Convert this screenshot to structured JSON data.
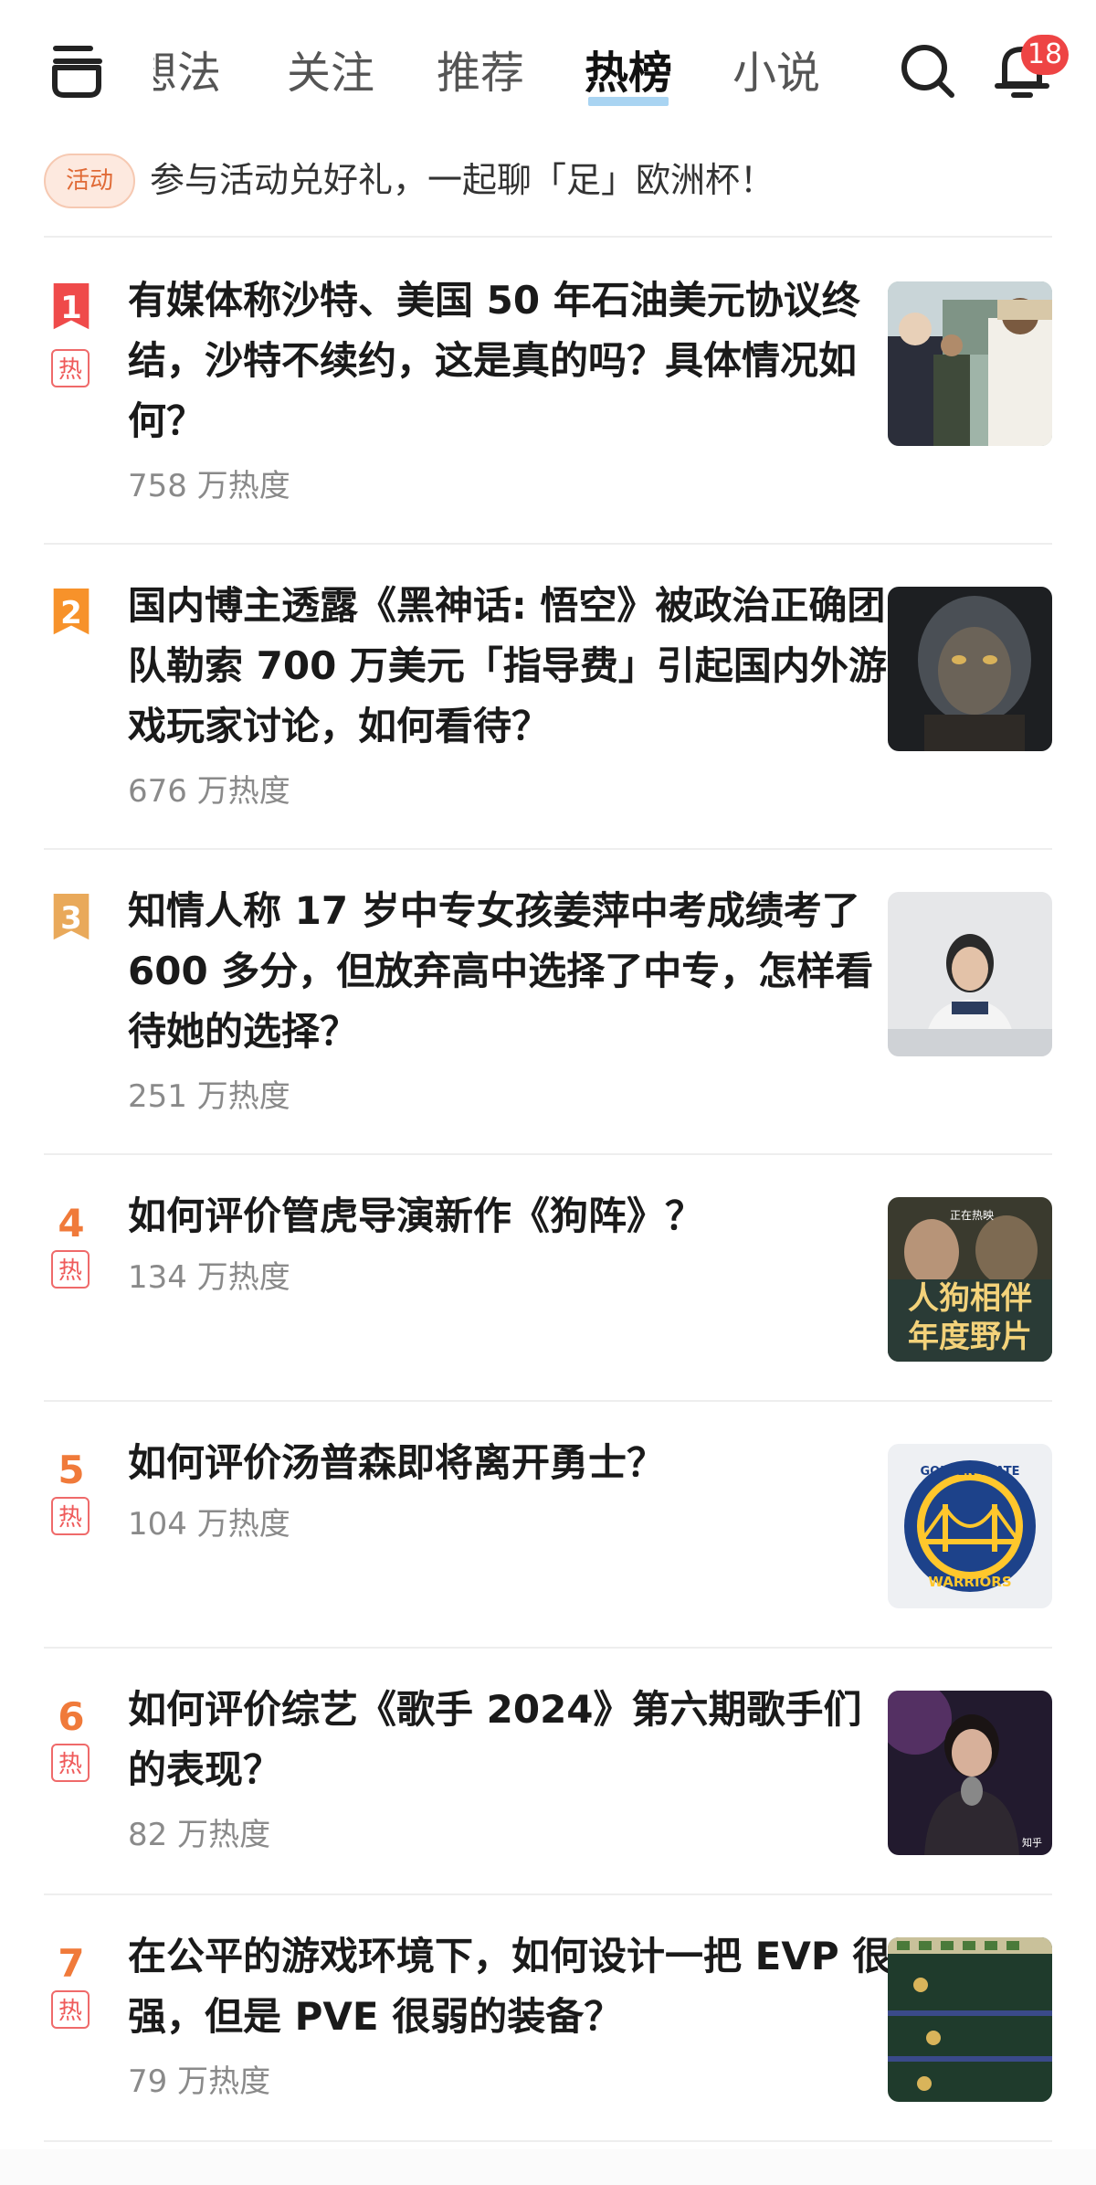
{
  "nav": {
    "tabs": [
      "想法",
      "关注",
      "推荐",
      "热榜",
      "小说"
    ],
    "active_tab": "热榜",
    "notification_count": "18"
  },
  "activity": {
    "tag": "活动",
    "text": "参与活动兑好礼，一起聊「足」欧洲杯！"
  },
  "hot_list": [
    {
      "rank": "1",
      "title": "有媒体称沙特、美国 50 年石油美元协议终结，沙特不续约，这是真的吗？具体情况如何？",
      "heat": "758 万热度",
      "hot": true,
      "thumb": "meeting-photo"
    },
    {
      "rank": "2",
      "title": "国内博主透露《黑神话: 悟空》被政治正确团队勒索 700 万美元「指导费」引起国内外游戏玩家讨论，如何看待？",
      "heat": "676 万热度",
      "hot": false,
      "thumb": "wukong-game-art"
    },
    {
      "rank": "3",
      "title": "知情人称 17 岁中专女孩姜萍中考成绩考了 600 多分，但放弃高中选择了中专，怎样看待她的选择？",
      "heat": "251 万热度",
      "hot": false,
      "thumb": "student-photo"
    },
    {
      "rank": "4",
      "title": "如何评价管虎导演新作《狗阵》？",
      "heat": "134 万热度",
      "hot": true,
      "thumb": "movie-poster",
      "thumb_text_top": "正在热映",
      "thumb_text_1": "人狗相伴",
      "thumb_text_2": "年度野片"
    },
    {
      "rank": "5",
      "title": "如何评价汤普森即将离开勇士？",
      "heat": "104 万热度",
      "hot": true,
      "thumb": "warriors-logo",
      "thumb_text_top": "GOLDEN STATE",
      "thumb_text_bottom": "WARRIORS"
    },
    {
      "rank": "6",
      "title": "如何评价综艺《歌手 2024》第六期歌手们的表现？",
      "heat": "82 万热度",
      "hot": true,
      "thumb": "singer-photo",
      "thumb_text_corner": "知乎"
    },
    {
      "rank": "7",
      "title": "在公平的游戏环境下，如何设计一把 EVP 很强，但是 PVE 很弱的装备？",
      "heat": "79 万热度",
      "hot": true,
      "thumb": "game-screenshot"
    }
  ],
  "labels": {
    "hot_tag": "热"
  },
  "colors": {
    "rank_1": "#ef4a4a",
    "rank_2": "#f7922a",
    "rank_3": "#e9a95a",
    "rank_other": "#f07a3a",
    "hot_tag": "#ef5a5a",
    "tab_underline": "#a9d4f2",
    "badge": "#ee4444"
  }
}
